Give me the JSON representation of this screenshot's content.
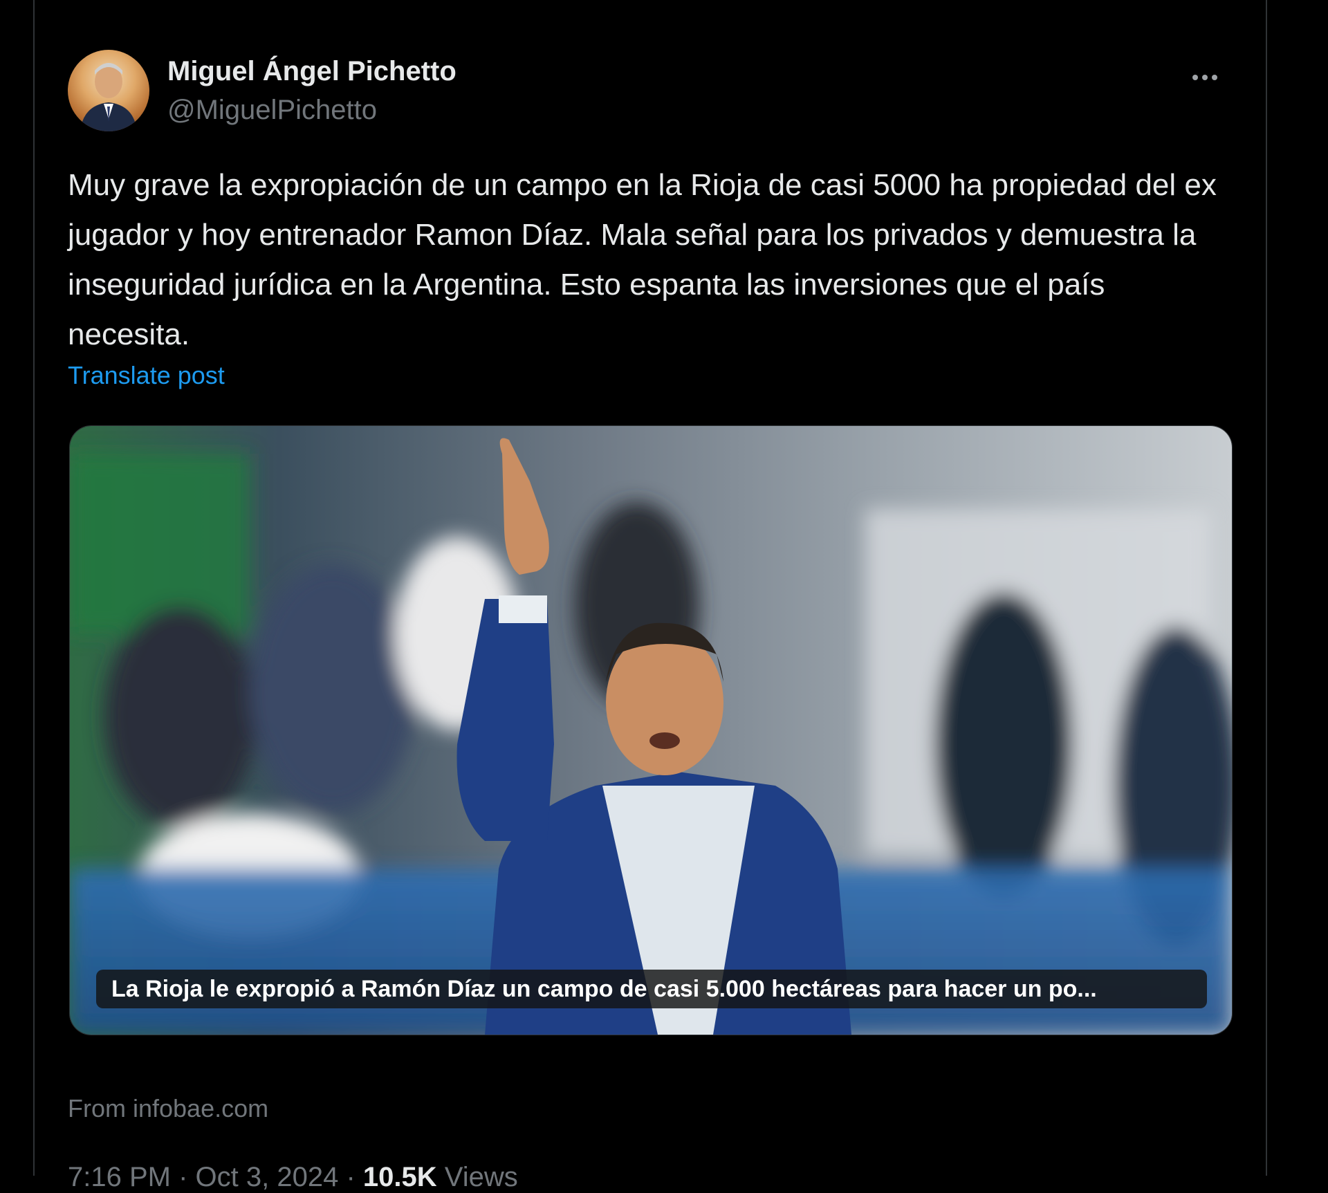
{
  "author": {
    "display_name": "Miguel Ángel Pichetto",
    "handle": "@MiguelPichetto",
    "avatar_icon": "profile-photo"
  },
  "more_icon": "more-options-icon",
  "post": {
    "text": "Muy grave la expropiación de un campo en la Rioja de casi 5000 ha propiedad del ex jugador y hoy entrenador Ramon Díaz. Mala señal para los privados y demuestra la inseguridad jurídica en la Argentina. Esto espanta las inversiones que el país necesita.",
    "translate_label": "Translate post"
  },
  "link_card": {
    "caption": "La Rioja le expropió a Ramón Díaz un campo de casi 5.000 hectáreas para hacer un po...",
    "source": "From infobae.com"
  },
  "meta": {
    "time": "7:16 PM",
    "separator": "·",
    "date": "Oct 3, 2024",
    "views_count": "10.5K",
    "views_label": "Views"
  },
  "colors": {
    "background": "#000000",
    "text": "#e7e9ea",
    "secondary": "#71767b",
    "link": "#1d9bf0"
  }
}
